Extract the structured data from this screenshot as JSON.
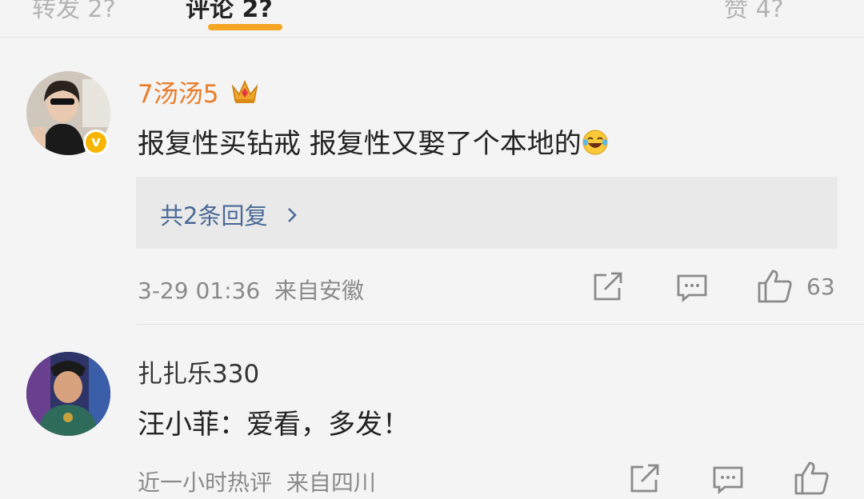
{
  "tabs": [
    {
      "label": "转发 2?"
    },
    {
      "label": "评论 2?"
    },
    {
      "label": "赞 4?"
    }
  ],
  "comments": [
    {
      "username": "7汤汤5",
      "username_color": "#e87d2a",
      "text": "报复性买钻戒 报复性又娶了个本地的",
      "emoji": "laughing-tears",
      "replies_label": "共2条回复",
      "timestamp": "3-29 01:36",
      "location": "来自安徽",
      "likes": "63"
    },
    {
      "username": "扎扎乐330",
      "username_color": "#333333",
      "text": "汪小菲：爱看，多发！",
      "timestamp": "近一小时热评",
      "location": "来自四川"
    }
  ]
}
